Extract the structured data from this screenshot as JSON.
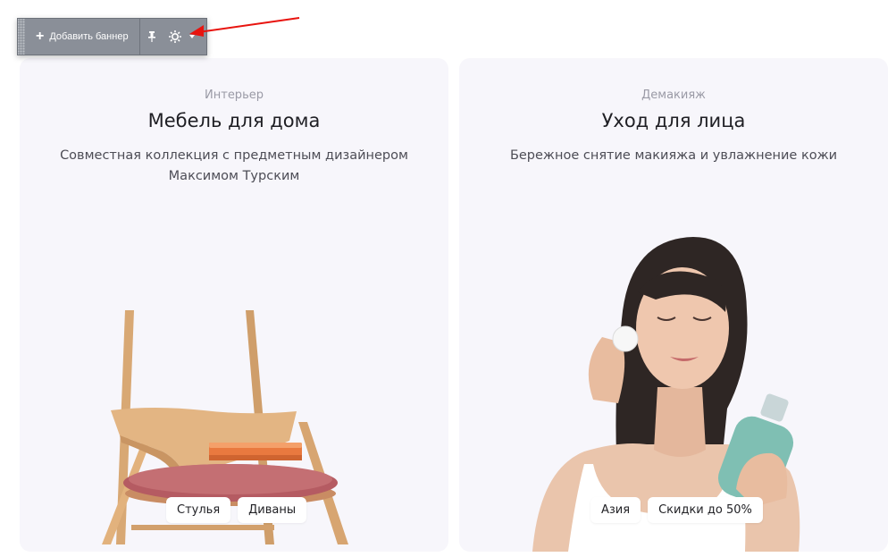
{
  "toolbar": {
    "add_banner_label": "Добавить баннер",
    "icons": [
      "plus-icon",
      "pin-icon",
      "gear-icon",
      "chevron-down-icon"
    ]
  },
  "annotation": {
    "arrow_color": "#e8140f"
  },
  "banners": [
    {
      "eyebrow": "Интерьер",
      "title": "Мебель для дома",
      "description": "Совместная коллекция с предметным дизайнером Максимом Турским",
      "tags": [
        "Стулья",
        "Диваны"
      ]
    },
    {
      "eyebrow": "Демакияж",
      "title": "Уход для лица",
      "description": "Бережное снятие макияжа и увлажнение кожи",
      "tags": [
        "Азия",
        "Скидки до 50%"
      ]
    }
  ],
  "colors": {
    "card_bg": "#f7f6fb",
    "toolbar_bg": "#8a8f98"
  }
}
